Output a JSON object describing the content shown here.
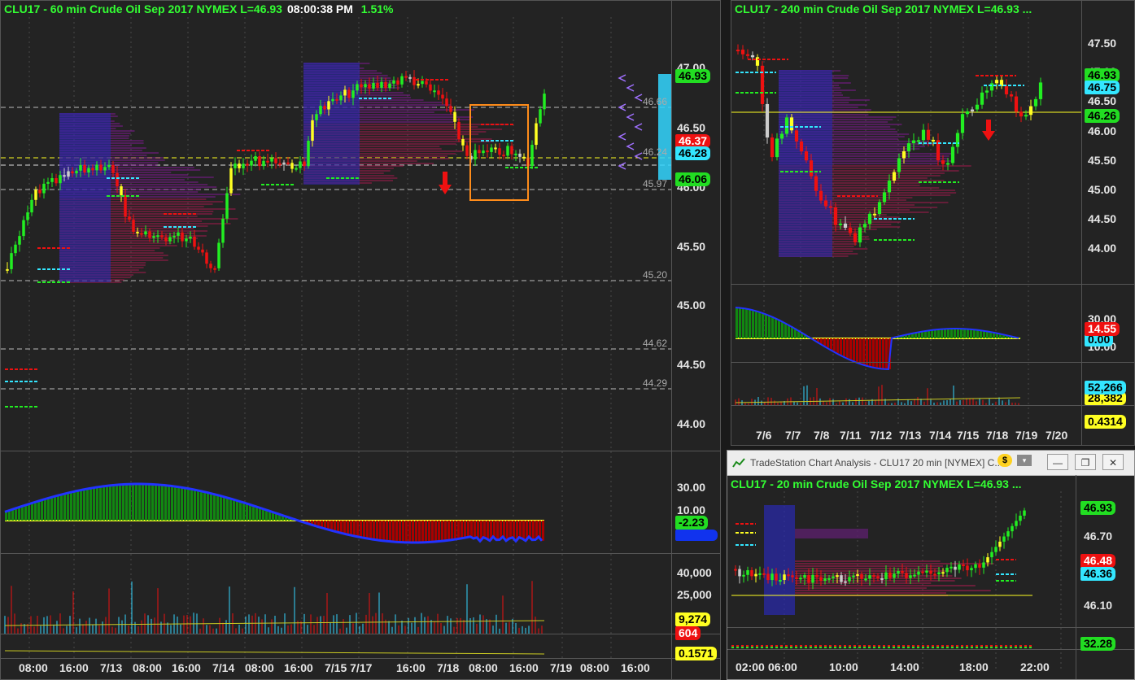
{
  "main": {
    "title_left": "CLU17 - 60 min  Crude Oil Sep 2017  NYMEX  L=46.93",
    "title_time": "08:00:38 PM",
    "title_pct": "1.51%",
    "price_axis": [
      "47.00",
      "46.50",
      "46.00",
      "45.50",
      "45.00",
      "44.50",
      "44.00"
    ],
    "tags": {
      "last": "46.93",
      "red": "46.37",
      "cyan": "46.28",
      "green": "46.06"
    },
    "levels": [
      "46.66",
      "46.24",
      "45.97",
      "45.20",
      "44.62",
      "44.29"
    ],
    "osc_axis": [
      "30.00",
      "10.00"
    ],
    "osc_tag": "-2.23",
    "vol_axis": [
      "40,000",
      "25,000"
    ],
    "vol_tags": {
      "yellow": "9,274",
      "red": "604"
    },
    "bottom_tag": "0.1571",
    "x_labels": [
      "08:00",
      "16:00",
      "7/13",
      "08:00",
      "16:00",
      "7/14",
      "08:00",
      "16:00",
      "7/15 7/17",
      "16:00",
      "7/18",
      "08:00",
      "16:00",
      "7/19",
      "08:00",
      "16:00"
    ]
  },
  "chart240": {
    "title": "CLU17 - 240 min  Crude Oil Sep 2017  NYMEX  L=46.93 ...",
    "price_axis": [
      "47.50",
      "47.00",
      "46.50",
      "46.00",
      "45.50",
      "45.00",
      "44.50",
      "44.00"
    ],
    "tags": {
      "last": "46.93",
      "cyan": "46.75",
      "green": "46.26"
    },
    "osc_axis": [
      "30.00",
      "10.00"
    ],
    "osc_tags": {
      "red": "14.55",
      "cyan": "0.00"
    },
    "vol_tags": {
      "cyan": "52,266",
      "yellow": "28,382"
    },
    "bottom_tag": "0.4314",
    "x_labels": [
      "7/6",
      "7/7",
      "7/8",
      "7/11",
      "7/12",
      "7/13",
      "7/14",
      "7/15",
      "7/18",
      "7/19",
      "7/20"
    ]
  },
  "chart20": {
    "window_title": "TradeStation Chart Analysis - CLU17 20 min [NYMEX] C...",
    "dollar_icon": "$",
    "title": "CLU17 - 20 min  Crude Oil Sep 2017  NYMEX  L=46.93 ...",
    "price_axis": [
      "46.70",
      "46.10"
    ],
    "tags": {
      "last": "46.93",
      "red": "46.48",
      "cyan": "46.36"
    },
    "osc_tag": "32.28",
    "x_labels": [
      "02:00",
      "06:00",
      "10:00",
      "14:00",
      "18:00",
      "22:00"
    ],
    "buttons": {
      "minimize": "—",
      "restore": "❐",
      "close": "✕"
    }
  },
  "colors": {
    "up": "#22ee22",
    "down": "#ee1111",
    "doji": "#ffff22",
    "neutral": "#cccccc",
    "bg": "#232323"
  }
}
